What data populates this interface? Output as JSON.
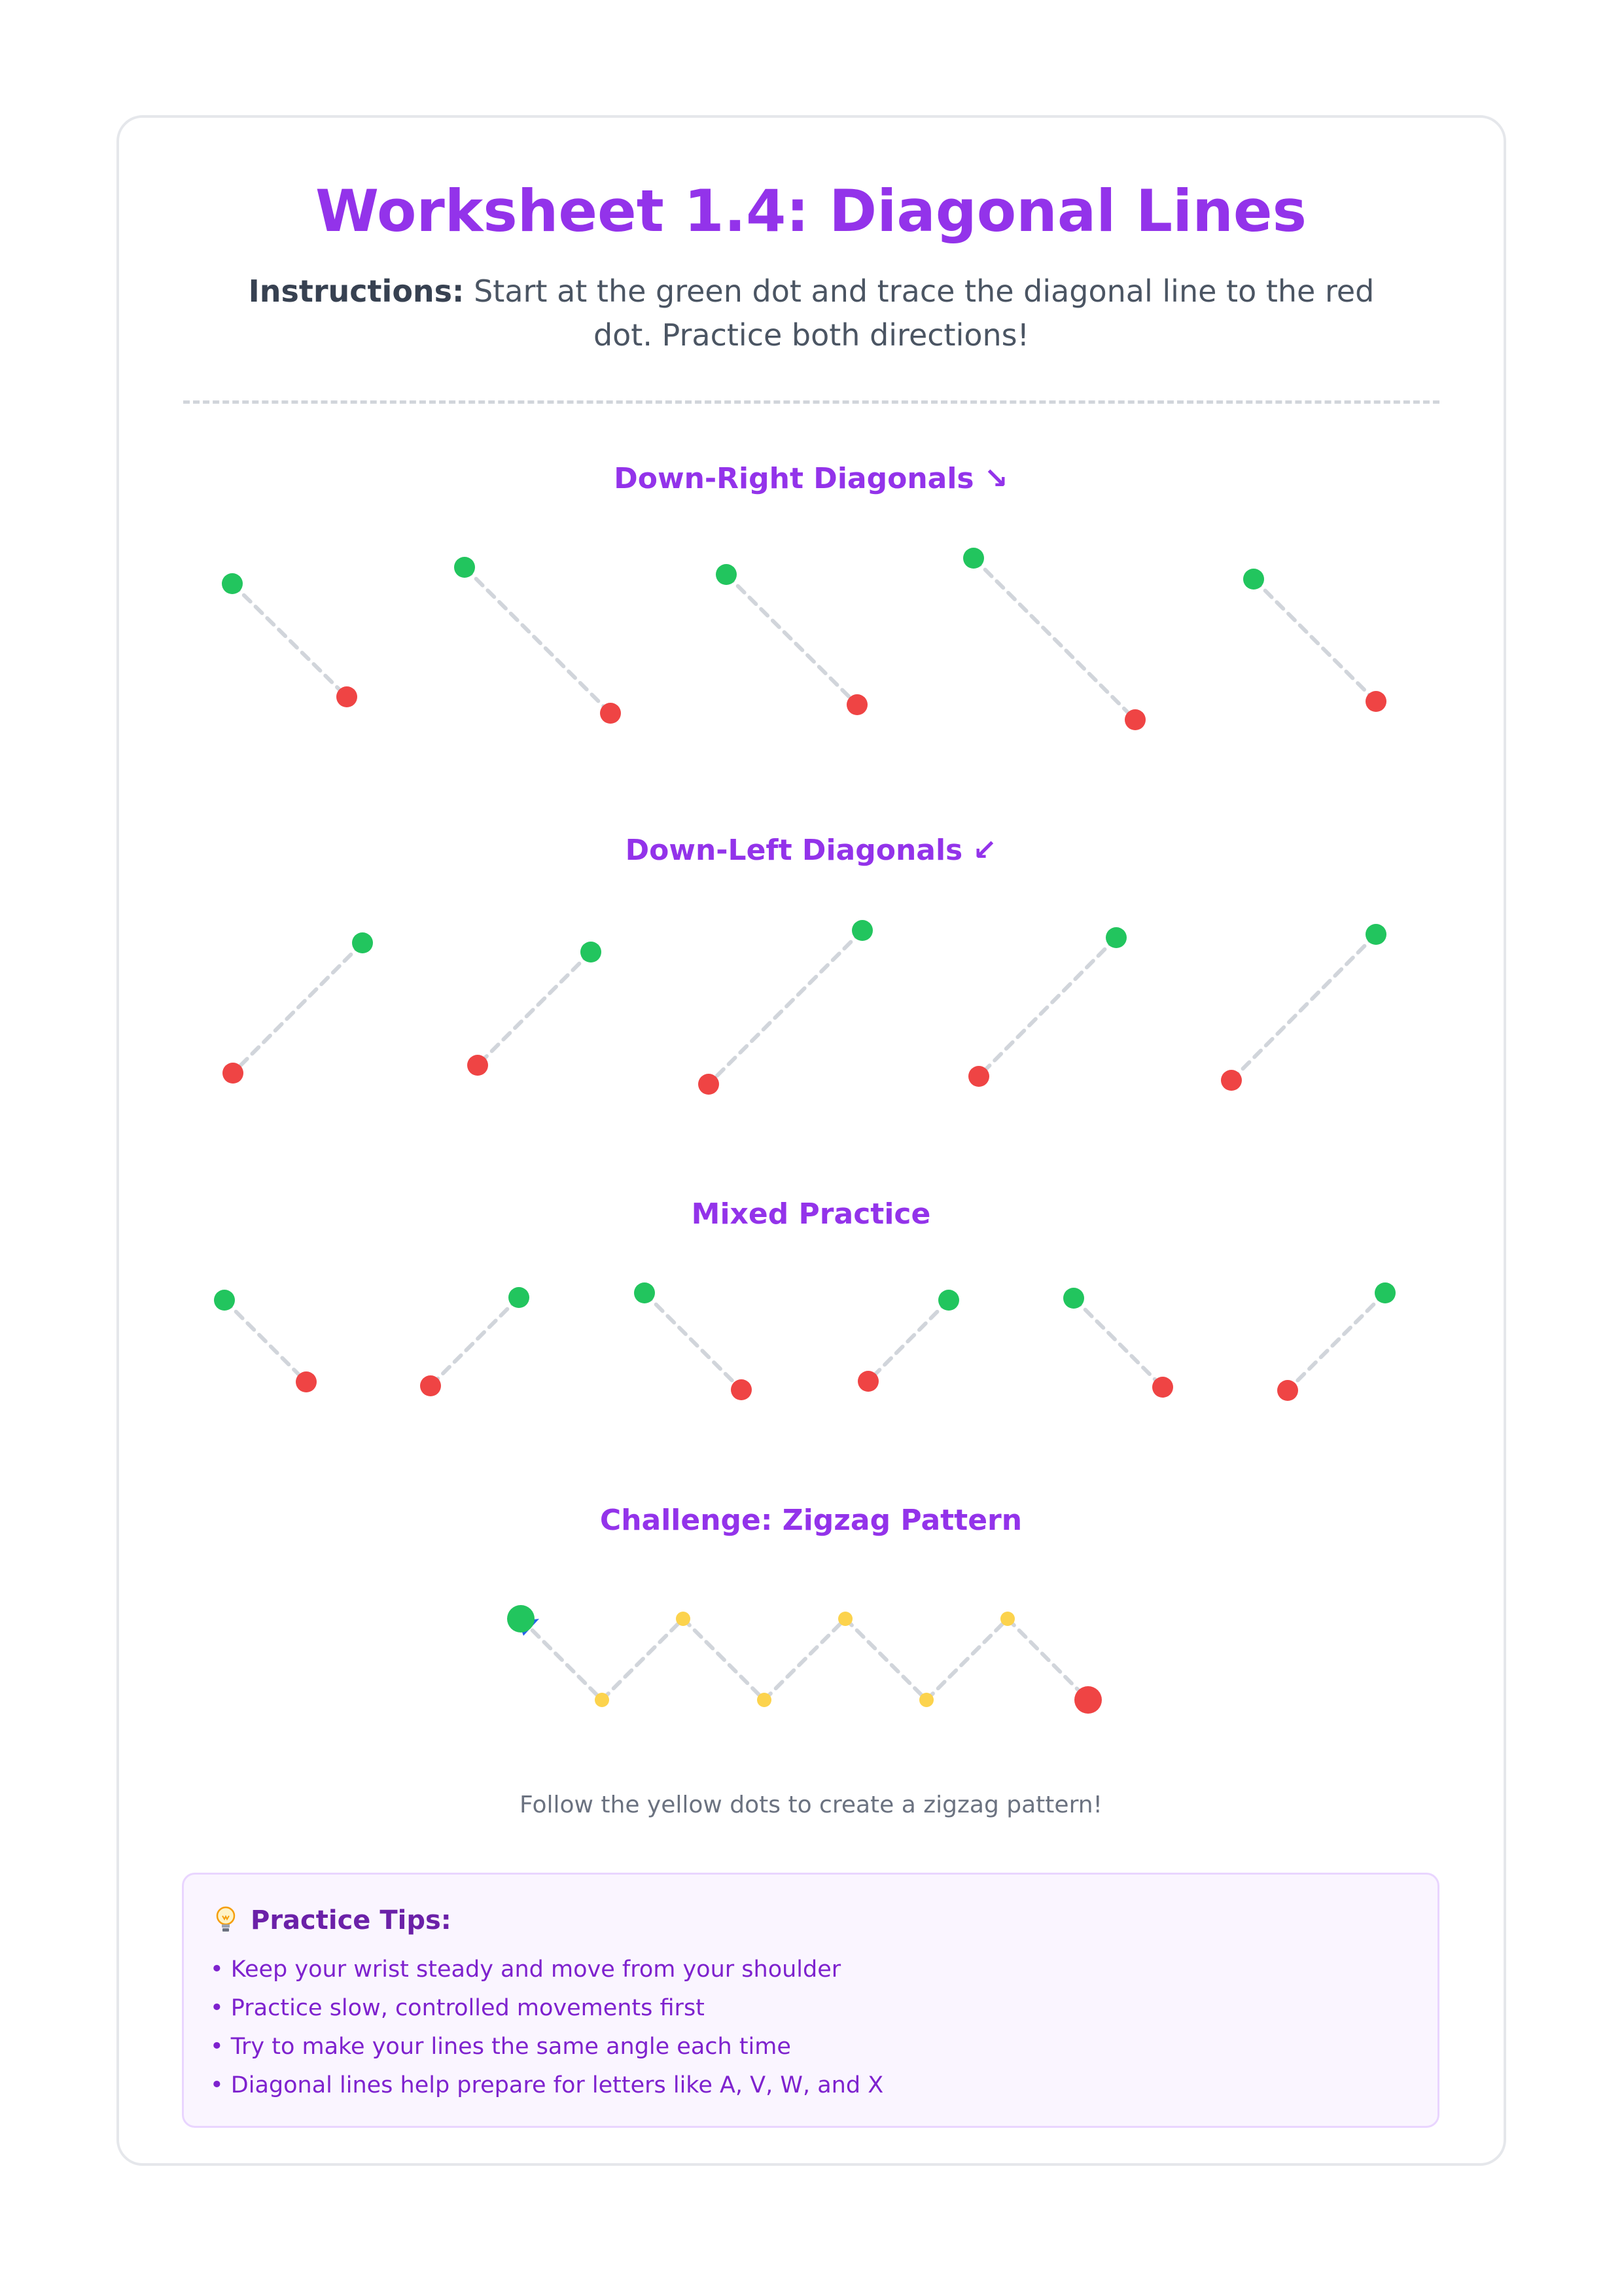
{
  "worksheet": {
    "title": "Worksheet 1.4: Diagonal Lines",
    "instructions_label": "Instructions:",
    "instructions_text": "Start at the green dot and trace the diagonal line to the red dot. Practice both directions!"
  },
  "sections": {
    "down_right": "Down-Right Diagonals ↘",
    "down_left": "Down-Left Diagonals ↙",
    "mixed": "Mixed Practice",
    "challenge": "Challenge: Zigzag Pattern"
  },
  "challenge_caption": "Follow the yellow dots to create a zigzag pattern!",
  "tips": {
    "icon": "lightbulb-icon",
    "title": "Practice Tips:",
    "items": [
      "• Keep your wrist steady and move from your shoulder",
      "• Practice slow, controlled movements first",
      "• Try to make your lines the same angle each time",
      "• Diagonal lines help prepare for letters like A, V, W, and X"
    ]
  },
  "colors": {
    "accent": "#9333ea",
    "start_dot": "#22c55e",
    "end_dot": "#ef4444",
    "waypoint_dot": "#fcd34d",
    "trace_line": "#d1d5db"
  }
}
